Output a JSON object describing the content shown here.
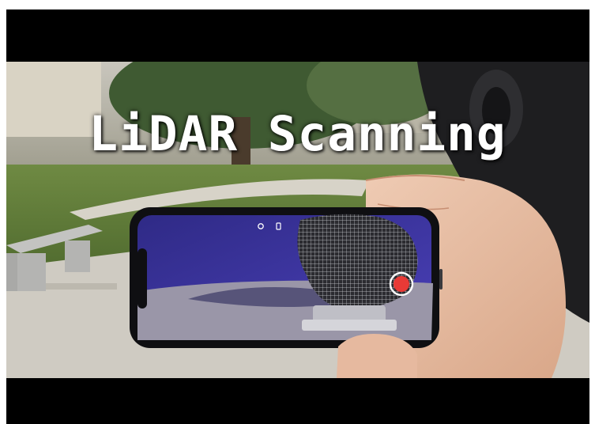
{
  "video": {
    "title": "LiDAR Scanning"
  },
  "icons": {
    "record": "record-button-icon",
    "settings": "settings-dot-icon",
    "trash": "trash-icon"
  },
  "colors": {
    "letterbox": "#000000",
    "scan_overlay": "#3b2fa0",
    "record_red": "#e83a36"
  }
}
